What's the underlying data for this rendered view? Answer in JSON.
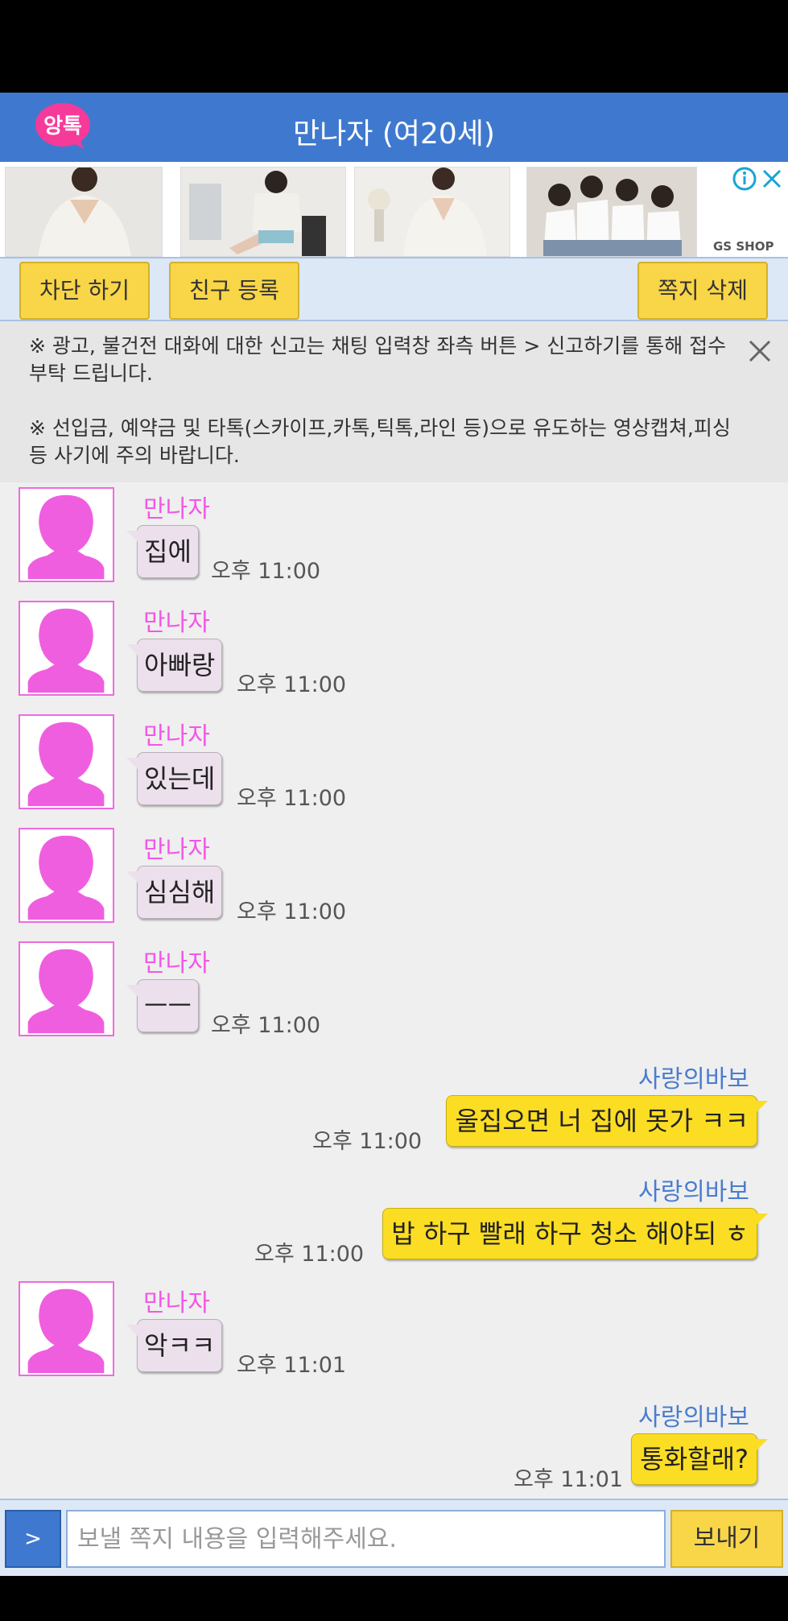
{
  "header": {
    "logo_text": "앙톡",
    "title": "만나자 (여20세)"
  },
  "ad": {
    "brand": "GS SHOP"
  },
  "toolbar": {
    "block_label": "차단 하기",
    "add_friend_label": "친구 등록",
    "delete_label": "쪽지 삭제"
  },
  "notice": {
    "line1": "※ 광고, 불건전 대화에 대한 신고는 채팅 입력창 좌측 버튼 > 신고하기를 통해 접수 부탁 드립니다.",
    "line2": "※ 선입금, 예약금 및 타톡(스카이프,카톡,틱톡,라인 등)으로 유도하는 영상캡쳐,피싱 등 사기에 주의 바랍니다."
  },
  "messages": [
    {
      "sender": "만나자",
      "text": "집에",
      "time": "오후 11:00"
    },
    {
      "sender": "만나자",
      "text": "아빠랑",
      "time": "오후 11:00"
    },
    {
      "sender": "만나자",
      "text": "있는데",
      "time": "오후 11:00"
    },
    {
      "sender": "만나자",
      "text": "심심해",
      "time": "오후 11:00"
    },
    {
      "sender": "만나자",
      "text": "ㅡㅡ",
      "time": "오후 11:00"
    },
    {
      "sender": "사랑의바보",
      "text": "울집오면  너 집에 못가 ㅋㅋ",
      "time": "오후 11:00"
    },
    {
      "sender": "사랑의바보",
      "text": "밥 하구 빨래 하구 청소 해야되 ㅎ",
      "time": "오후 11:00"
    },
    {
      "sender": "만나자",
      "text": "악ㅋㅋ",
      "time": "오후 11:01"
    },
    {
      "sender": "사랑의바보",
      "text": "통화할래?",
      "time": "오후 11:01"
    }
  ],
  "composer": {
    "menu_label": ">",
    "placeholder": "보낼 쪽지 내용을 입력해주세요.",
    "send_label": "보내기"
  },
  "colors": {
    "header": "#3f79cf",
    "button_yellow": "#f9d548",
    "incoming_name": "#f357e6",
    "outgoing_name": "#4a7ccf",
    "outgoing_bubble": "#fbdd24",
    "incoming_bubble": "#ece0ec"
  }
}
